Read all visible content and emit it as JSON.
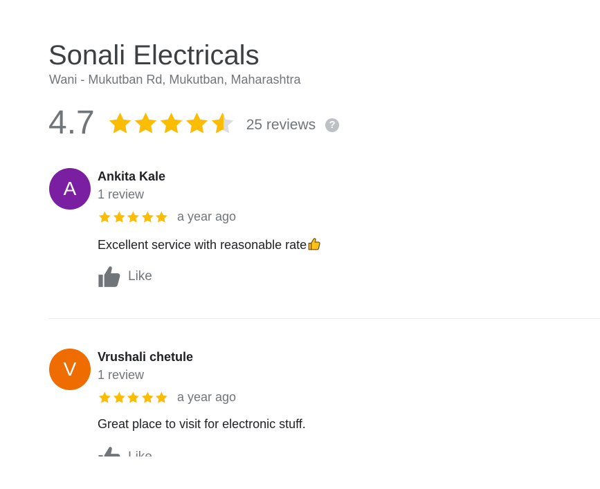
{
  "place": {
    "name": "Sonali Electricals",
    "address": "Wani - Mukutban Rd, Mukutban, Maharashtra",
    "rating": "4.7",
    "rating_value": 4.7,
    "reviews_count_text": "25 reviews",
    "help_icon": "?"
  },
  "colors": {
    "star": "#fbbc04",
    "star_empty": "#dadce0",
    "avatar_1": "#7b1fa2",
    "avatar_2": "#ef6c00",
    "icon_gray": "#70757a"
  },
  "reviews": [
    {
      "avatar_letter": "A",
      "name": "Ankita Kale",
      "meta": "1 review",
      "stars": 5,
      "time": "a year ago",
      "text": "Excellent service with reasonable rate",
      "emoji": "thumbs-up-emoji",
      "like_label": "Like"
    },
    {
      "avatar_letter": "V",
      "name": "Vrushali chetule",
      "meta": "1 review",
      "stars": 5,
      "time": "a year ago",
      "text": "Great place to visit for electronic stuff.",
      "like_label": "Like"
    }
  ]
}
